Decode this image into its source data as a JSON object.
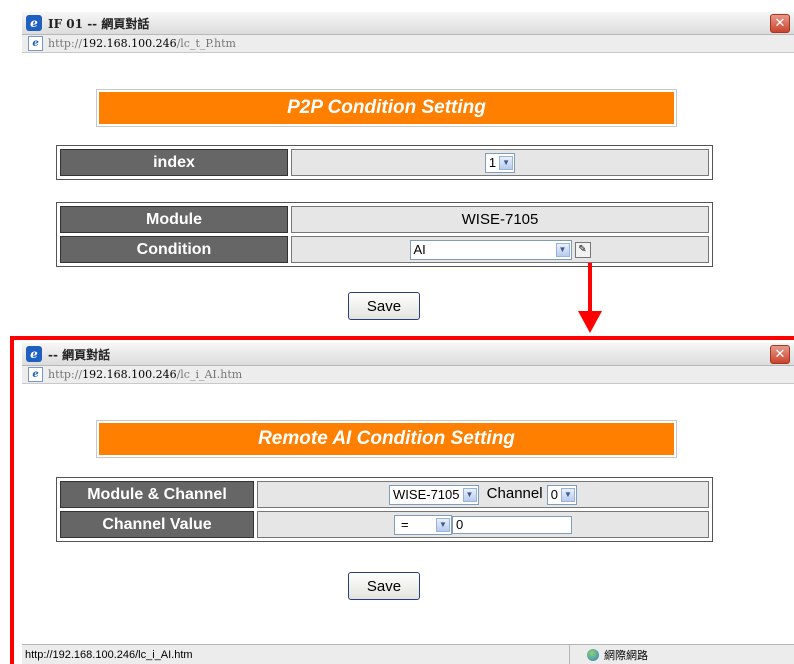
{
  "window1": {
    "title": "IF 01 -- 網頁對話",
    "address": {
      "scheme": "http://",
      "host": "192.168.100.246",
      "path": "/lc_t_P.htm"
    },
    "close_label": "✕",
    "heading": "P2P Condition Setting",
    "index": {
      "label": "index",
      "value": "1"
    },
    "module": {
      "label": "Module",
      "value": "WISE-7105"
    },
    "condition": {
      "label": "Condition",
      "value": "AI"
    },
    "save_label": "Save"
  },
  "window2": {
    "title": "-- 網頁對話",
    "address": {
      "scheme": "http://",
      "host": "192.168.100.246",
      "path": "/lc_i_AI.htm"
    },
    "close_label": "✕",
    "heading": "Remote AI Condition Setting",
    "module_channel": {
      "label": "Module & Channel",
      "module_value": "WISE-7105",
      "channel_label": "Channel",
      "channel_value": "0"
    },
    "channel_value": {
      "label": "Channel Value",
      "operator": "=",
      "value": "0"
    },
    "save_label": "Save",
    "status": {
      "url": "http://192.168.100.246/lc_i_AI.htm",
      "zone": "網際網路"
    }
  },
  "colors": {
    "accent": "#ff7f00",
    "label_bg": "#666666",
    "value_bg": "#e6e6e6",
    "arrow": "#ff0000"
  },
  "icons": {
    "browser": "ie-icon",
    "close": "close-icon",
    "edit": "edit-icon",
    "zone": "globe-icon"
  }
}
